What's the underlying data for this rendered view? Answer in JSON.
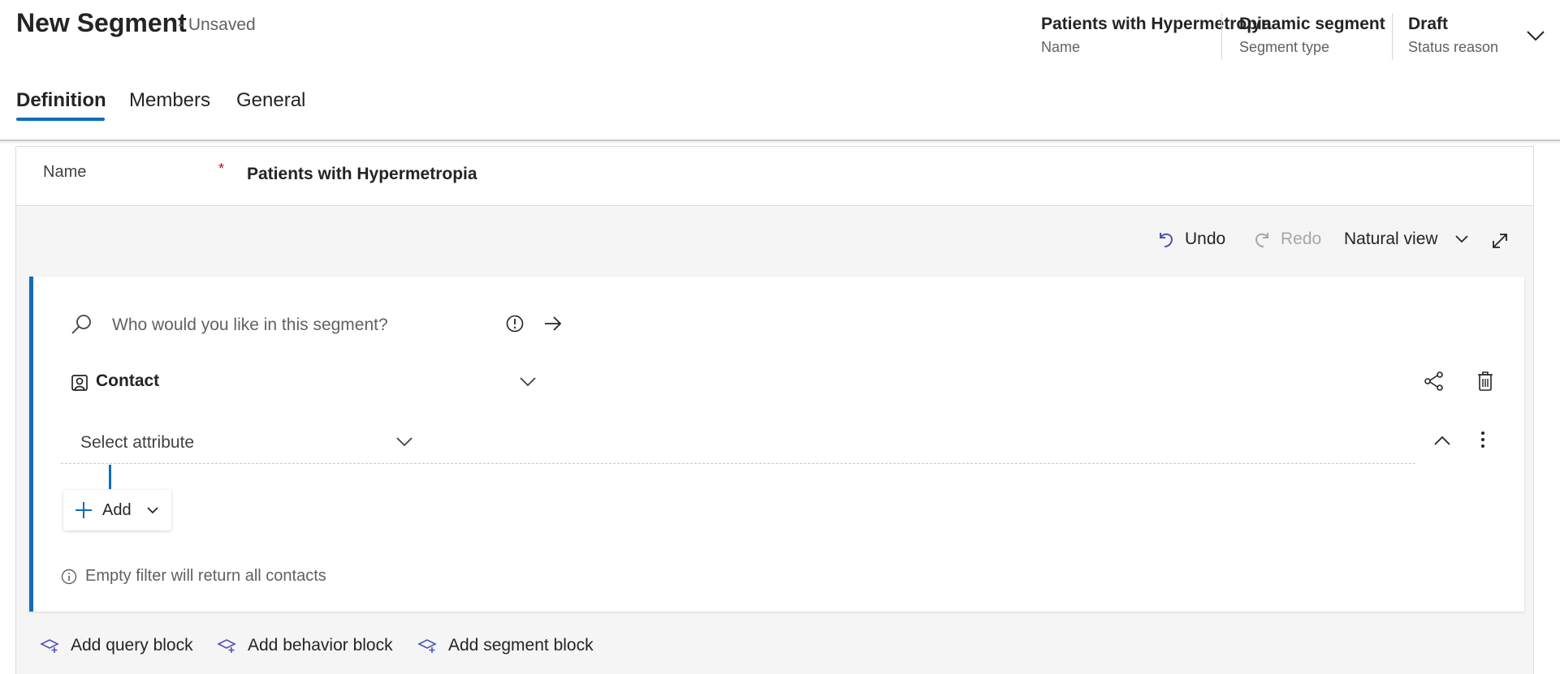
{
  "header": {
    "title": "New Segment",
    "status": "- Unsaved",
    "fields": [
      {
        "value": "Patients with Hypermetropia",
        "label": "Name"
      },
      {
        "value": "Dynamic segment",
        "label": "Segment type"
      },
      {
        "value": "Draft",
        "label": "Status reason"
      }
    ]
  },
  "tabs": [
    {
      "label": "Definition",
      "active": true
    },
    {
      "label": "Members",
      "active": false
    },
    {
      "label": "General",
      "active": false
    }
  ],
  "form": {
    "name_label": "Name",
    "required_mark": "*",
    "name_value": "Patients with Hypermetropia"
  },
  "toolbar": {
    "undo": "Undo",
    "redo": "Redo",
    "view": "Natural view"
  },
  "query": {
    "search_placeholder": "Who would you like in this segment?",
    "entity": "Contact",
    "attribute_placeholder": "Select attribute",
    "add_label": "Add",
    "empty_note": "Empty filter will return all contacts"
  },
  "bottom_actions": {
    "query_block": "Add query block",
    "behavior_block": "Add behavior block",
    "segment_block": "Add segment block"
  },
  "colors": {
    "accent": "#0f6cbd",
    "add_block_icon": "#4f52b2",
    "required": "#c50f1f"
  }
}
